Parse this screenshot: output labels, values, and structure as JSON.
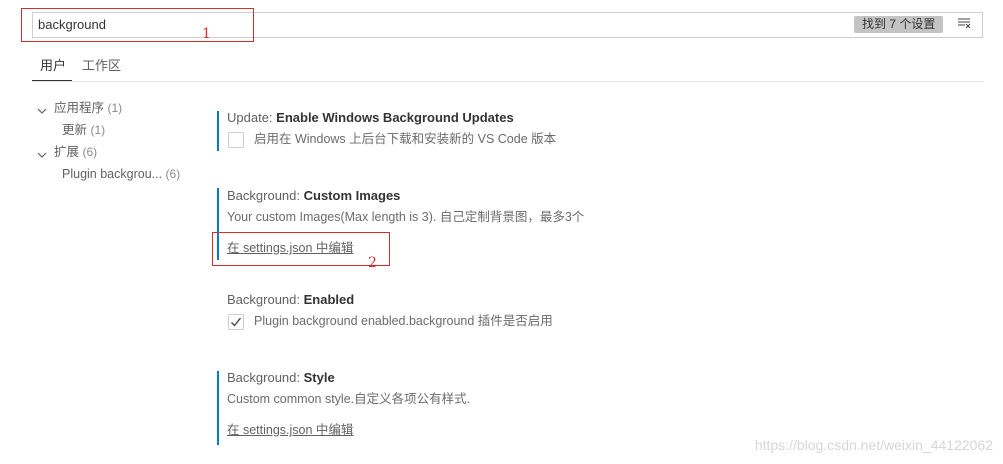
{
  "search": {
    "value": "background",
    "result_count": "找到 7 个设置",
    "filter_icon": "clear-filter-icon"
  },
  "annotations": {
    "box1_number": "1",
    "box2_number": "2",
    "color": "#d32f2f"
  },
  "tabs": [
    {
      "label": "用户",
      "active": true
    },
    {
      "label": "工作区",
      "active": false
    }
  ],
  "toc": [
    {
      "label": "应用程序",
      "count": "(1)",
      "expanded": true
    },
    {
      "label": "更新",
      "count": "(1)"
    },
    {
      "label": "扩展",
      "count": "(6)",
      "expanded": true
    },
    {
      "label": "Plugin backgrou...",
      "count": "(6)"
    }
  ],
  "settings": [
    {
      "category": "Update: ",
      "name": "Enable Windows Background Updates",
      "checkbox_label": "启用在 Windows 上后台下载和安装新的 VS Code 版本",
      "checked": false
    },
    {
      "category": "Background: ",
      "name": "Custom Images",
      "description": "Your custom Images(Max length is 3). 自己定制背景图，最多3个",
      "link": "在 settings.json 中编辑"
    },
    {
      "category": "Background: ",
      "name": "Enabled",
      "checkbox_label": "Plugin background enabled.background 插件是否启用",
      "checked": true
    },
    {
      "category": "Background: ",
      "name": "Style",
      "description": "Custom common style.自定义各项公有样式.",
      "link": "在 settings.json 中编辑"
    }
  ],
  "colors": {
    "accent": "#007acc"
  },
  "watermark": "https://blog.csdn.net/weixin_44122062"
}
